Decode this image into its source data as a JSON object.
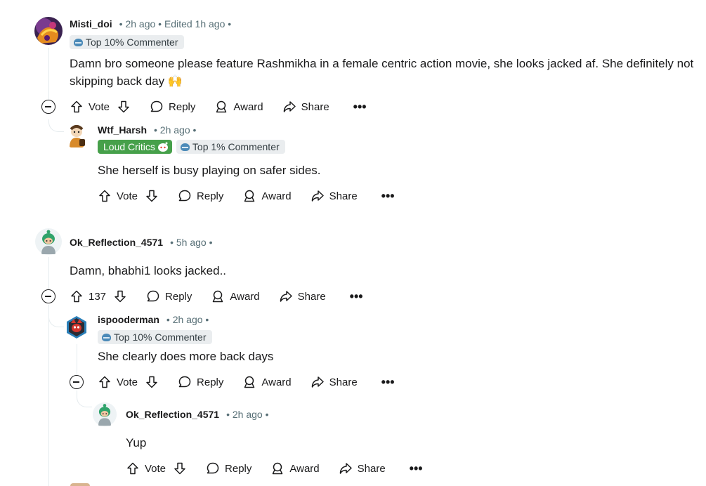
{
  "comments": [
    {
      "username": "Misti_doi",
      "meta": "• 2h ago • Edited 1h ago •",
      "flairs": [
        "Top 10% Commenter"
      ],
      "body": "Damn bro someone please feature Rashmikha in a female centric action movie, she looks jacked af. She definitely not skipping back day 🙌",
      "actions": {
        "vote": "Vote",
        "reply": "Reply",
        "award": "Award",
        "share": "Share",
        "more": "•••"
      }
    },
    {
      "username": "Wtf_Harsh",
      "meta": "• 2h ago •",
      "flairs": [
        "Loud Critics",
        "Top 1% Commenter"
      ],
      "body": "She herself is busy playing on safer sides.",
      "actions": {
        "vote": "Vote",
        "reply": "Reply",
        "award": "Award",
        "share": "Share",
        "more": "•••"
      }
    },
    {
      "username": "Ok_Reflection_4571",
      "meta": "• 5h ago •",
      "flairs": [],
      "body": "Damn, bhabhi1 looks jacked..",
      "actions": {
        "vote": "137",
        "reply": "Reply",
        "award": "Award",
        "share": "Share",
        "more": "•••"
      }
    },
    {
      "username": "ispooderman",
      "meta": "• 2h ago •",
      "flairs": [
        "Top 10% Commenter"
      ],
      "body": "She clearly does more back days",
      "actions": {
        "vote": "Vote",
        "reply": "Reply",
        "award": "Award",
        "share": "Share",
        "more": "•••"
      }
    },
    {
      "username": "Ok_Reflection_4571",
      "meta": "• 2h ago •",
      "flairs": [],
      "body": "Yup",
      "actions": {
        "vote": "Vote",
        "reply": "Reply",
        "award": "Award",
        "share": "Share",
        "more": "•••"
      }
    }
  ],
  "icons": {
    "upvote": "arrow-up-icon",
    "downvote": "arrow-down-icon",
    "reply": "speech-bubble-icon",
    "award": "award-icon",
    "share": "share-arrow-icon",
    "collapse": "collapse-minus-icon"
  },
  "colors": {
    "text": "#1a1a1b",
    "meta": "#576f76",
    "flair_bg": "#eaedef",
    "loud_critics_bg": "#46a04a",
    "thread_line": "#e5ebee"
  }
}
